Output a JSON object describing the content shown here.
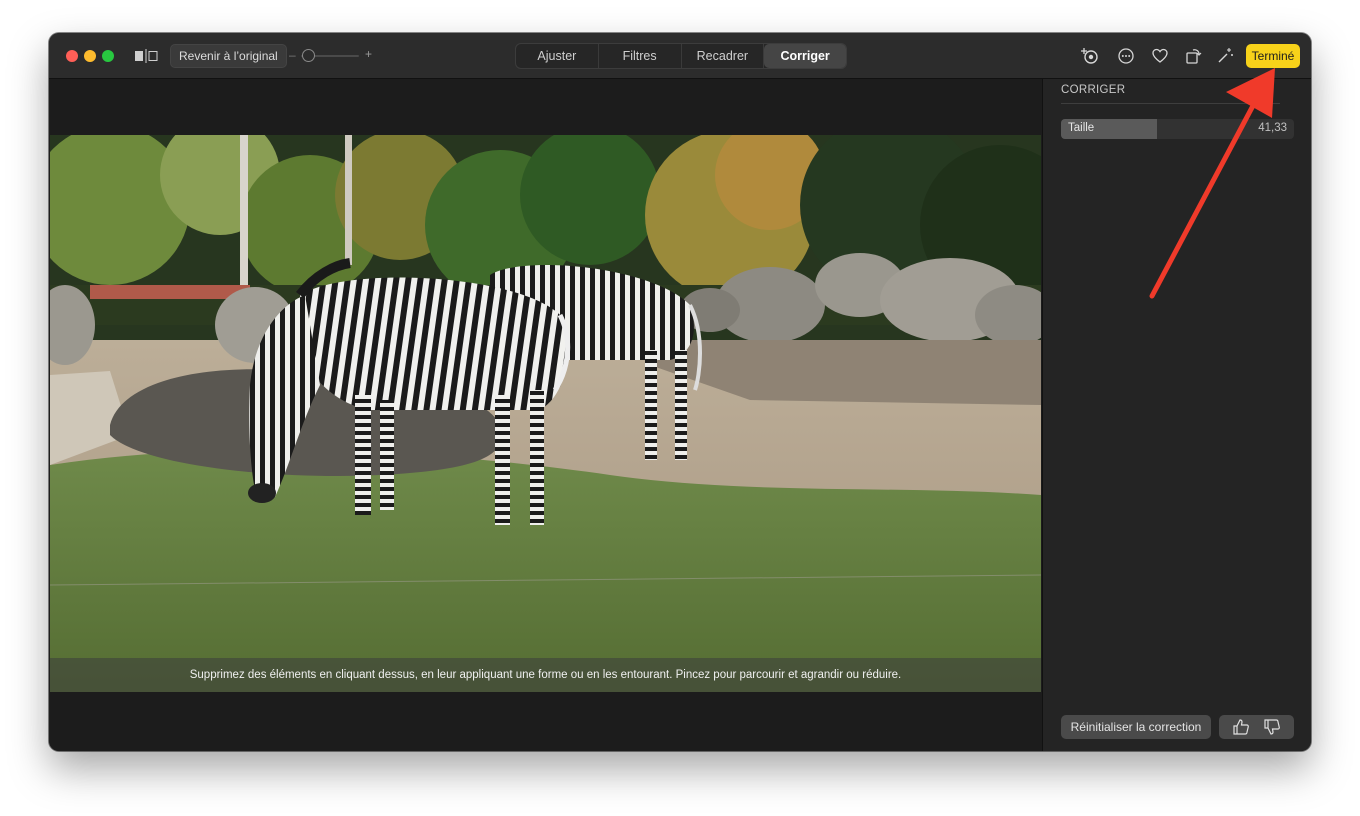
{
  "toolbar": {
    "revert_label": "Revenir à l’original",
    "zoom_minus": "–",
    "zoom_plus": "+",
    "tabs": [
      {
        "label": "Ajuster",
        "active": false
      },
      {
        "label": "Filtres",
        "active": false
      },
      {
        "label": "Recadrer",
        "active": false
      },
      {
        "label": "Corriger",
        "active": true
      }
    ],
    "done_label": "Terminé",
    "icons": [
      "window-close",
      "window-minimize",
      "window-maximize",
      "compare-icon",
      "enhance-icon",
      "more-icon",
      "heart-icon",
      "rotate-icon",
      "magic-wand-icon"
    ],
    "accent": "#f7d21a"
  },
  "photo": {
    "hint": "Supprimez des éléments en cliquant dessus, en leur appliquant une forme ou en les entourant. Pincez pour parcourir et agrandir ou réduire."
  },
  "sidebar": {
    "title": "CORRIGER",
    "size_label": "Taille",
    "size_value": "41,33",
    "size_fill_fraction": 0.41,
    "reset_label": "Réinitialiser la correction",
    "feedback_icons": [
      "thumbs-up-icon",
      "thumbs-down-icon"
    ]
  },
  "annotation": {
    "arrow_color": "#f03a2a"
  }
}
